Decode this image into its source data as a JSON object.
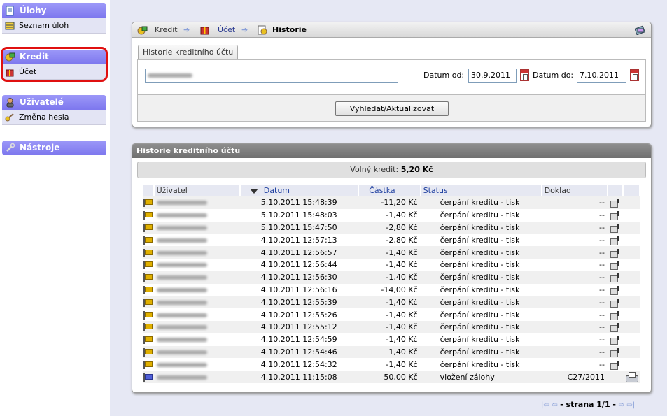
{
  "sidebar": {
    "groups": [
      {
        "title": "Úlohy",
        "icon": "document-icon",
        "items": [
          "Seznam úloh"
        ]
      },
      {
        "title": "Kredit",
        "icon": "credit-icon",
        "items": [
          "Účet"
        ]
      },
      {
        "title": "Uživatelé",
        "icon": "user-icon",
        "items": [
          "Změna hesla"
        ]
      },
      {
        "title": "Nástroje",
        "icon": "wrench-icon",
        "items": []
      }
    ]
  },
  "breadcrumb": {
    "items": [
      "Kredit",
      "Účet",
      "Historie"
    ]
  },
  "filter": {
    "tab_label": "Historie kreditního účtu",
    "user_value": "",
    "date_from_label": "Datum od:",
    "date_from": "30.9.2011",
    "date_to_label": "Datum do:",
    "date_to": "7.10.2011",
    "submit_label": "Vyhledat/Aktualizovat"
  },
  "history": {
    "title": "Historie kreditního účtu",
    "balance_label": "Volný kredit:",
    "balance_value": "5,20 Kč",
    "columns": [
      "Uživatel",
      "Datum",
      "Částka",
      "Status",
      "Doklad"
    ],
    "rows": [
      {
        "flag": "yellow",
        "date": "5.10.2011 15:48:39",
        "amount": "-11,20 Kč",
        "status": "čerpání kreditu - tisk",
        "doc": "--"
      },
      {
        "flag": "yellow",
        "date": "5.10.2011 15:48:03",
        "amount": "-1,40 Kč",
        "status": "čerpání kreditu - tisk",
        "doc": "--"
      },
      {
        "flag": "yellow",
        "date": "5.10.2011 15:47:50",
        "amount": "-2,80 Kč",
        "status": "čerpání kreditu - tisk",
        "doc": "--"
      },
      {
        "flag": "yellow",
        "date": "4.10.2011 12:57:13",
        "amount": "-2,80 Kč",
        "status": "čerpání kreditu - tisk",
        "doc": "--"
      },
      {
        "flag": "yellow",
        "date": "4.10.2011 12:56:57",
        "amount": "-1,40 Kč",
        "status": "čerpání kreditu - tisk",
        "doc": "--"
      },
      {
        "flag": "yellow",
        "date": "4.10.2011 12:56:44",
        "amount": "-1,40 Kč",
        "status": "čerpání kreditu - tisk",
        "doc": "--"
      },
      {
        "flag": "yellow",
        "date": "4.10.2011 12:56:30",
        "amount": "-1,40 Kč",
        "status": "čerpání kreditu - tisk",
        "doc": "--"
      },
      {
        "flag": "yellow",
        "date": "4.10.2011 12:56:16",
        "amount": "-14,00 Kč",
        "status": "čerpání kreditu - tisk",
        "doc": "--"
      },
      {
        "flag": "yellow",
        "date": "4.10.2011 12:55:39",
        "amount": "-1,40 Kč",
        "status": "čerpání kreditu - tisk",
        "doc": "--"
      },
      {
        "flag": "yellow",
        "date": "4.10.2011 12:55:26",
        "amount": "-1,40 Kč",
        "status": "čerpání kreditu - tisk",
        "doc": "--"
      },
      {
        "flag": "yellow",
        "date": "4.10.2011 12:55:12",
        "amount": "-1,40 Kč",
        "status": "čerpání kreditu - tisk",
        "doc": "--"
      },
      {
        "flag": "yellow",
        "date": "4.10.2011 12:54:59",
        "amount": "-1,40 Kč",
        "status": "čerpání kreditu - tisk",
        "doc": "--"
      },
      {
        "flag": "yellow",
        "date": "4.10.2011 12:54:46",
        "amount": "1,40 Kč",
        "status": "čerpání kreditu - tisk",
        "doc": "--"
      },
      {
        "flag": "yellow",
        "date": "4.10.2011 12:54:32",
        "amount": "-1,40 Kč",
        "status": "čerpání kreditu - tisk",
        "doc": "--"
      },
      {
        "flag": "blue",
        "date": "4.10.2011 11:15:08",
        "amount": "50,00 Kč",
        "status": "vložení zálohy",
        "doc": "C27/2011"
      }
    ]
  },
  "pager": {
    "label": "- strana 1/1 -"
  },
  "colors": {
    "sidebar_header": "#8a85f4",
    "panel_header": "#7f7f7f",
    "highlight": "#e01010",
    "background": "#e6e8f4"
  }
}
